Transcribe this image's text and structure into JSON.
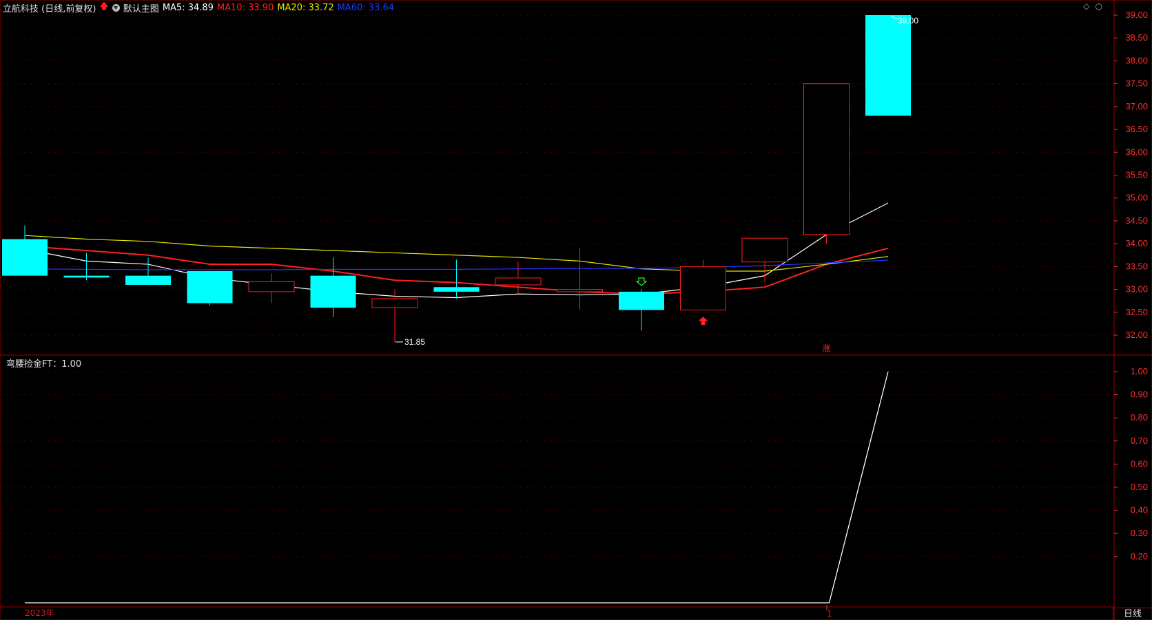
{
  "header": {
    "stock_title": "立航科技 (日线,前复权)",
    "template_name": "默认主图",
    "ma": [
      {
        "label": "MA5: 34.89",
        "color": "#ffffff"
      },
      {
        "label": "MA10: 33.90",
        "color": "#ff2020"
      },
      {
        "label": "MA20: 33.72",
        "color": "#e6e600"
      },
      {
        "label": "MA60: 33.64",
        "color": "#1a3cff"
      }
    ]
  },
  "indicator": {
    "label": "弯腰捡金FT：1.00"
  },
  "annotations": {
    "high_label": "39.00",
    "low_label": "31.85",
    "zhang_label": "涨"
  },
  "axis": {
    "year_label": "2023年",
    "month_label": "1",
    "period_label": "日线"
  },
  "colors": {
    "up": "#ff2020",
    "down": "#00ffff",
    "grid": "#7a0000",
    "axis_text": "#ff3030"
  },
  "chart_data": [
    {
      "type": "candlestick",
      "y_ticks": [
        "39.00",
        "38.50",
        "38.00",
        "37.50",
        "37.00",
        "36.50",
        "36.00",
        "35.50",
        "35.00",
        "34.50",
        "34.00",
        "33.50",
        "33.00",
        "32.50",
        "32.00"
      ],
      "ylim": [
        31.5,
        39.2
      ],
      "candles": [
        {
          "o": 34.1,
          "h": 34.4,
          "l": 33.3,
          "c": 33.3,
          "dir": "down"
        },
        {
          "o": 33.3,
          "h": 33.8,
          "l": 33.2,
          "c": 33.26,
          "dir": "down"
        },
        {
          "o": 33.3,
          "h": 33.7,
          "l": 33.1,
          "c": 33.1,
          "dir": "down"
        },
        {
          "o": 33.4,
          "h": 33.4,
          "l": 32.65,
          "c": 32.7,
          "dir": "down"
        },
        {
          "o": 32.95,
          "h": 33.35,
          "l": 32.7,
          "c": 33.17,
          "dir": "up"
        },
        {
          "o": 33.3,
          "h": 33.7,
          "l": 32.4,
          "c": 32.6,
          "dir": "down"
        },
        {
          "o": 32.6,
          "h": 33.0,
          "l": 31.85,
          "c": 32.8,
          "dir": "up"
        },
        {
          "o": 33.05,
          "h": 33.65,
          "l": 32.8,
          "c": 32.95,
          "dir": "down"
        },
        {
          "o": 33.1,
          "h": 33.6,
          "l": 32.9,
          "c": 33.25,
          "dir": "up"
        },
        {
          "o": 32.95,
          "h": 33.9,
          "l": 32.55,
          "c": 33.0,
          "dir": "up"
        },
        {
          "o": 32.95,
          "h": 33.0,
          "l": 32.1,
          "c": 32.55,
          "dir": "down"
        },
        {
          "o": 32.55,
          "h": 33.65,
          "l": 32.55,
          "c": 33.5,
          "dir": "up"
        },
        {
          "o": 33.6,
          "h": 34.12,
          "l": 33.15,
          "c": 34.12,
          "dir": "up"
        },
        {
          "o": 34.2,
          "h": 37.5,
          "l": 34.0,
          "c": 37.5,
          "dir": "up"
        },
        {
          "o": 39.0,
          "h": 39.0,
          "l": 36.8,
          "c": 36.8,
          "dir": "down"
        }
      ],
      "series": [
        {
          "name": "MA5",
          "color": "#ffffff",
          "values": [
            33.88,
            33.62,
            33.55,
            33.25,
            33.1,
            32.95,
            32.85,
            32.82,
            32.9,
            32.88,
            32.9,
            33.05,
            33.3,
            34.2,
            34.89
          ]
        },
        {
          "name": "MA10",
          "color": "#ff2020",
          "values": [
            33.95,
            33.85,
            33.75,
            33.55,
            33.55,
            33.4,
            33.2,
            33.15,
            33.05,
            32.95,
            32.9,
            32.95,
            33.05,
            33.55,
            33.9
          ]
        },
        {
          "name": "MA20",
          "color": "#e6e600",
          "values": [
            34.18,
            34.1,
            34.05,
            33.95,
            33.9,
            33.85,
            33.8,
            33.75,
            33.7,
            33.62,
            33.45,
            33.4,
            33.4,
            33.55,
            33.72
          ]
        },
        {
          "name": "MA60",
          "color": "#1a3cff",
          "values": [
            33.45,
            33.44,
            33.43,
            33.43,
            33.43,
            33.44,
            33.44,
            33.44,
            33.45,
            33.46,
            33.46,
            33.48,
            33.52,
            33.58,
            33.64
          ]
        }
      ]
    },
    {
      "type": "line",
      "y_ticks": [
        "1.00",
        "0.90",
        "0.80",
        "0.70",
        "0.60",
        "0.50",
        "0.40",
        "0.30",
        "0.20"
      ],
      "ylim": [
        0,
        1.05
      ],
      "series": [
        {
          "name": "弯腰捡金FT",
          "color": "#ffffff",
          "values": [
            0,
            0,
            0,
            0,
            0,
            0,
            0,
            0,
            0,
            0,
            0,
            0,
            0,
            0,
            1.0
          ]
        }
      ]
    }
  ]
}
